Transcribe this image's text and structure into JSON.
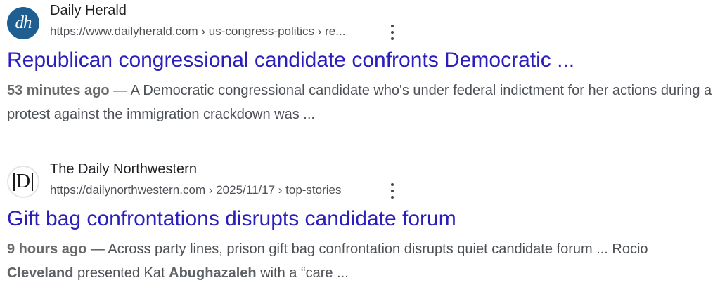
{
  "results": [
    {
      "favicon_text": "dh",
      "site_name": "Daily Herald",
      "url": "https://www.dailyherald.com › us-congress-politics › re...",
      "title": "Republican congressional candidate confronts Democratic ...",
      "date": "53 minutes ago",
      "dash": " — ",
      "snippet": "A Democratic congressional candidate who's under federal indictment for her actions during a protest against the immigration crackdown was ..."
    },
    {
      "favicon_text": "D",
      "site_name": "The Daily Northwestern",
      "url": "https://dailynorthwestern.com › 2025/11/17 › top-stories",
      "title": "Gift bag confrontations disrupts candidate forum",
      "date": "9 hours ago",
      "dash": " — ",
      "snippet_part1": "Across party lines, prison gift bag confrontation disrupts quiet candidate forum ... Rocio ",
      "snippet_bold1": "Cleveland",
      "snippet_part2": " presented Kat ",
      "snippet_bold2": "Abughazaleh",
      "snippet_part3": " with a “care ..."
    }
  ],
  "colors": {
    "title_link": "#2a1fbd",
    "dh_favicon_bg": "#1f5e91"
  },
  "icons": {
    "more_options": "kebab-vertical-icon"
  }
}
